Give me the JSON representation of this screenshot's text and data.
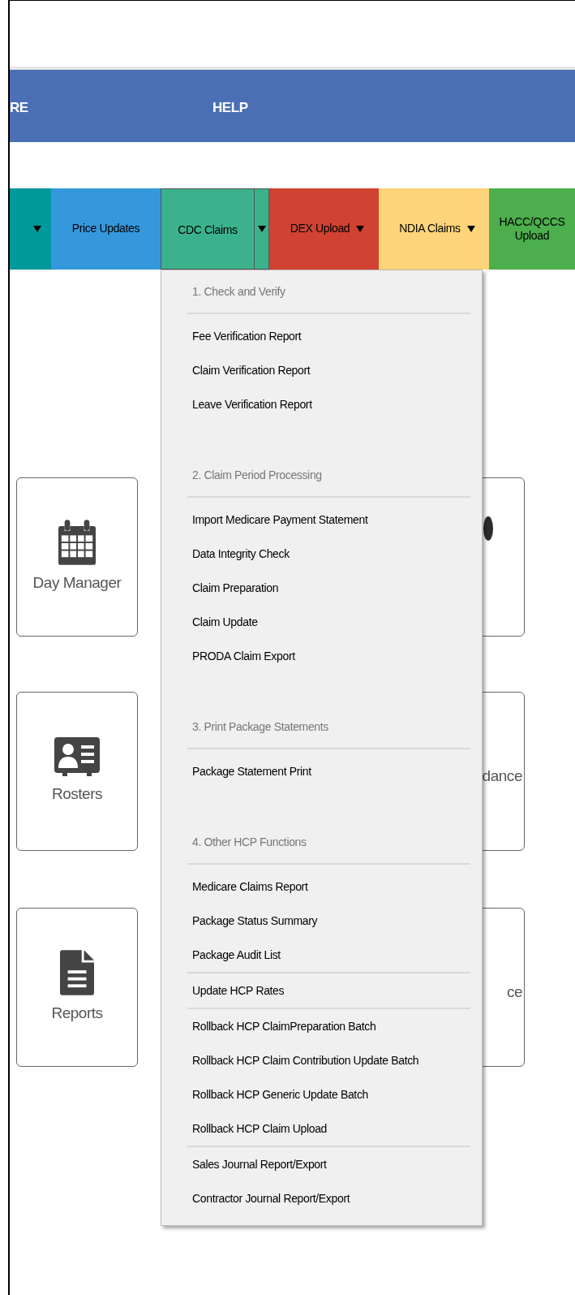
{
  "top_nav": {
    "items": [
      "RE",
      "HELP"
    ]
  },
  "tabs": [
    {
      "color": "#009999",
      "dropdown": true,
      "selected": false
    },
    {
      "label": "Price Updates",
      "color": "#3598dc",
      "dropdown": false,
      "selected": false
    },
    {
      "label": "CDC Claims",
      "color": "#3bb28c",
      "dropdown": true,
      "selected": true
    },
    {
      "label": "DEX Upload",
      "color": "#d04232",
      "dropdown": true,
      "selected": false
    },
    {
      "label": "NDIA Claims",
      "color": "#fed47a",
      "dropdown": true,
      "selected": false
    },
    {
      "label": "HACC/QCCS Upload",
      "color": "#4cae4c",
      "dropdown": false,
      "selected": false
    }
  ],
  "tiles_left": [
    {
      "label": "Day Manager"
    },
    {
      "label": "Rosters"
    },
    {
      "label": "Reports"
    }
  ],
  "tiles_right": [
    {
      "kind": "icon"
    },
    {
      "kind": "text",
      "label": "dance"
    },
    {
      "kind": "text",
      "label": "ce"
    }
  ],
  "dropdown_menu": {
    "groups": [
      {
        "heading": "1. Check and Verify",
        "items": [
          "Fee Verification Report",
          "Claim Verification Report",
          "Leave Verification Report"
        ]
      },
      {
        "heading": "2. Claim Period Processing",
        "items": [
          "Import Medicare Payment Statement",
          "Data Integrity Check",
          "Claim Preparation",
          "Claim Update",
          "PRODA Claim Export"
        ]
      },
      {
        "heading": "3. Print Package Statements",
        "items": [
          "Package Statement Print"
        ]
      },
      {
        "heading": "4. Other HCP Functions",
        "items": [
          "Medicare Claims Report",
          "Package Status Summary",
          "Package Audit List"
        ]
      },
      {
        "items": [
          "Update HCP Rates"
        ]
      },
      {
        "items": [
          "Rollback HCP ClaimPreparation Batch",
          "Rollback HCP Claim Contribution Update Batch",
          "Rollback HCP Generic Update Batch",
          "Rollback HCP Claim Upload"
        ]
      },
      {
        "items": [
          "Sales Journal Report/Export",
          "Contractor Journal Report/Export"
        ]
      }
    ]
  }
}
